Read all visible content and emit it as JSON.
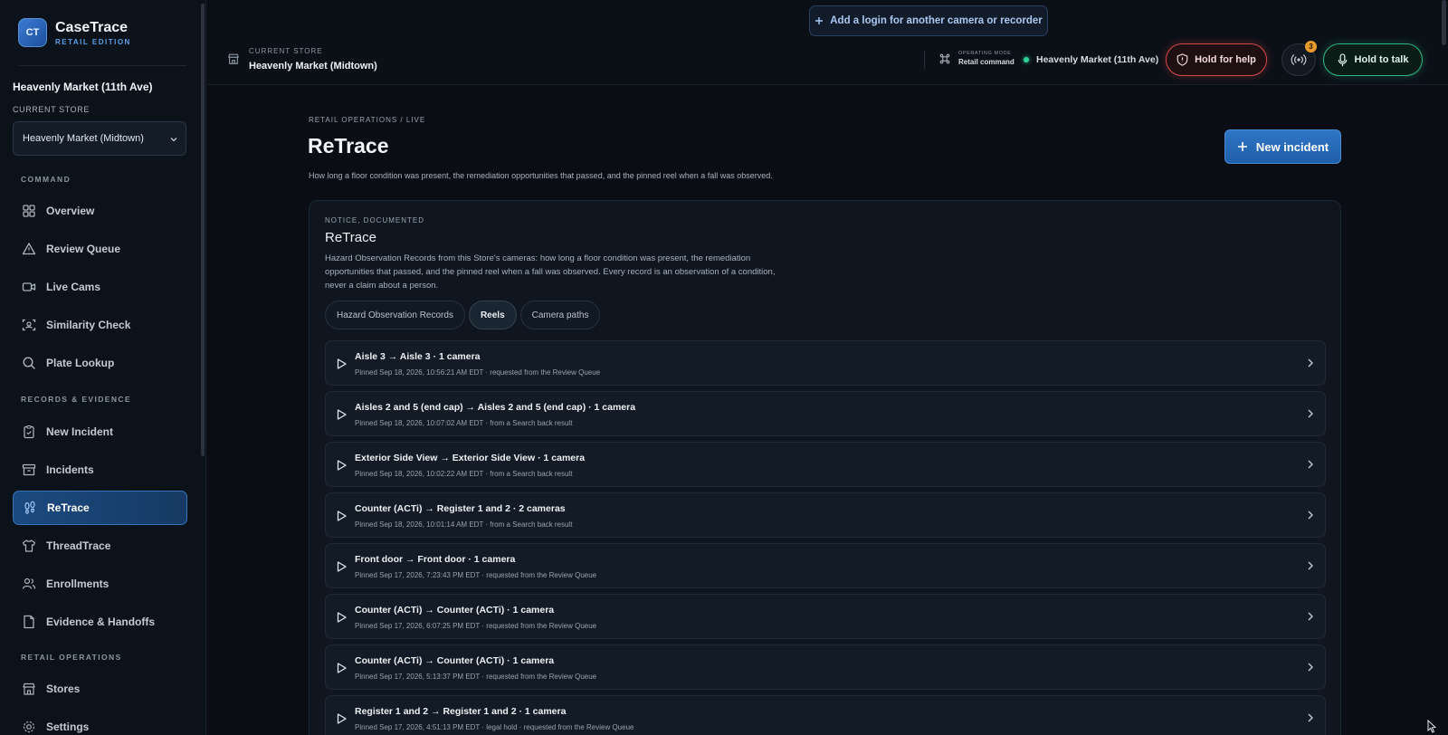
{
  "brand": {
    "logo": "CT",
    "name": "CaseTrace",
    "edition": "RETAIL EDITION"
  },
  "sidebar": {
    "store_name": "Heavenly Market (11th Ave)",
    "store_label": "CURRENT STORE",
    "store_select": "Heavenly Market (Midtown)",
    "sections": {
      "command": "COMMAND",
      "records": "RECORDS & EVIDENCE",
      "retail": "RETAIL OPERATIONS"
    },
    "items": [
      {
        "label": "Overview",
        "icon": "grid-icon"
      },
      {
        "label": "Review Queue",
        "icon": "alert-triangle-icon"
      },
      {
        "label": "Live Cams",
        "icon": "video-camera-icon"
      },
      {
        "label": "Similarity Check",
        "icon": "face-scan-icon"
      },
      {
        "label": "Plate Lookup",
        "icon": "search-icon"
      },
      {
        "label": "New Incident",
        "icon": "clipboard-icon"
      },
      {
        "label": "Incidents",
        "icon": "archive-box-icon"
      },
      {
        "label": "ReTrace",
        "icon": "footprints-icon"
      },
      {
        "label": "ThreadTrace",
        "icon": "shirt-icon"
      },
      {
        "label": "Enrollments",
        "icon": "users-icon"
      },
      {
        "label": "Evidence & Handoffs",
        "icon": "document-icon"
      },
      {
        "label": "Stores",
        "icon": "store-icon"
      },
      {
        "label": "Settings",
        "icon": "gear-icon"
      }
    ]
  },
  "topbar": {
    "add_login": "Add a login for another camera or recorder",
    "current_store_label": "CURRENT STORE",
    "current_store": "Heavenly Market (Midtown)",
    "op_mode_label": "OPERATING MODE",
    "op_mode_value": "Retail command",
    "location": "Heavenly Market (11th Ave)",
    "help": "Hold for help",
    "badge_count": "3",
    "talk": "Hold to talk"
  },
  "main": {
    "breadcrumb": "RETAIL OPERATIONS / LIVE",
    "title": "ReTrace",
    "subtitle": "How long a floor condition was present, the remediation opportunities that passed, and the pinned reel when a fall was observed.",
    "new_incident": "New incident",
    "card": {
      "eyebrow": "NOTICE, DOCUMENTED",
      "title": "ReTrace",
      "description": "Hazard Observation Records from this Store's cameras: how long a floor condition was present, the remediation opportunities that passed, and the pinned reel when a fall was observed. Every record is an observation of a condition, never a claim about a person.",
      "tabs": [
        "Hazard Observation Records",
        "Reels",
        "Camera paths"
      ],
      "active_tab": "Reels",
      "reels": [
        {
          "title": "Aisle 3 → Aisle 3 · 1 camera",
          "meta": "Pinned Sep 18, 2026, 10:56:21 AM EDT · requested from the Review Queue"
        },
        {
          "title": "Aisles 2 and 5 (end cap) → Aisles 2 and 5 (end cap) · 1 camera",
          "meta": "Pinned Sep 18, 2026, 10:07:02 AM EDT · from a Search back result"
        },
        {
          "title": "Exterior Side View → Exterior Side View · 1 camera",
          "meta": "Pinned Sep 18, 2026, 10:02:22 AM EDT · from a Search back result"
        },
        {
          "title": "Counter (ACTi) → Register 1 and 2 · 2 cameras",
          "meta": "Pinned Sep 18, 2026, 10:01:14 AM EDT · from a Search back result"
        },
        {
          "title": "Front door → Front door · 1 camera",
          "meta": "Pinned Sep 17, 2026, 7:23:43 PM EDT · requested from the Review Queue"
        },
        {
          "title": "Counter (ACTi) → Counter (ACTi) · 1 camera",
          "meta": "Pinned Sep 17, 2026, 6:07:25 PM EDT · requested from the Review Queue"
        },
        {
          "title": "Counter (ACTi) → Counter (ACTi) · 1 camera",
          "meta": "Pinned Sep 17, 2026, 5:13:37 PM EDT · requested from the Review Queue"
        },
        {
          "title": "Register 1 and 2 → Register 1 and 2 · 1 camera",
          "meta": "Pinned Sep 17, 2026, 4:51:13 PM EDT · legal hold · requested from the Review Queue"
        }
      ]
    }
  },
  "colors": {
    "accent": "#2f76c6",
    "help": "#d44848",
    "talk": "#2bb784",
    "badge": "#e89a2c",
    "live_dot": "#2fd29a"
  }
}
